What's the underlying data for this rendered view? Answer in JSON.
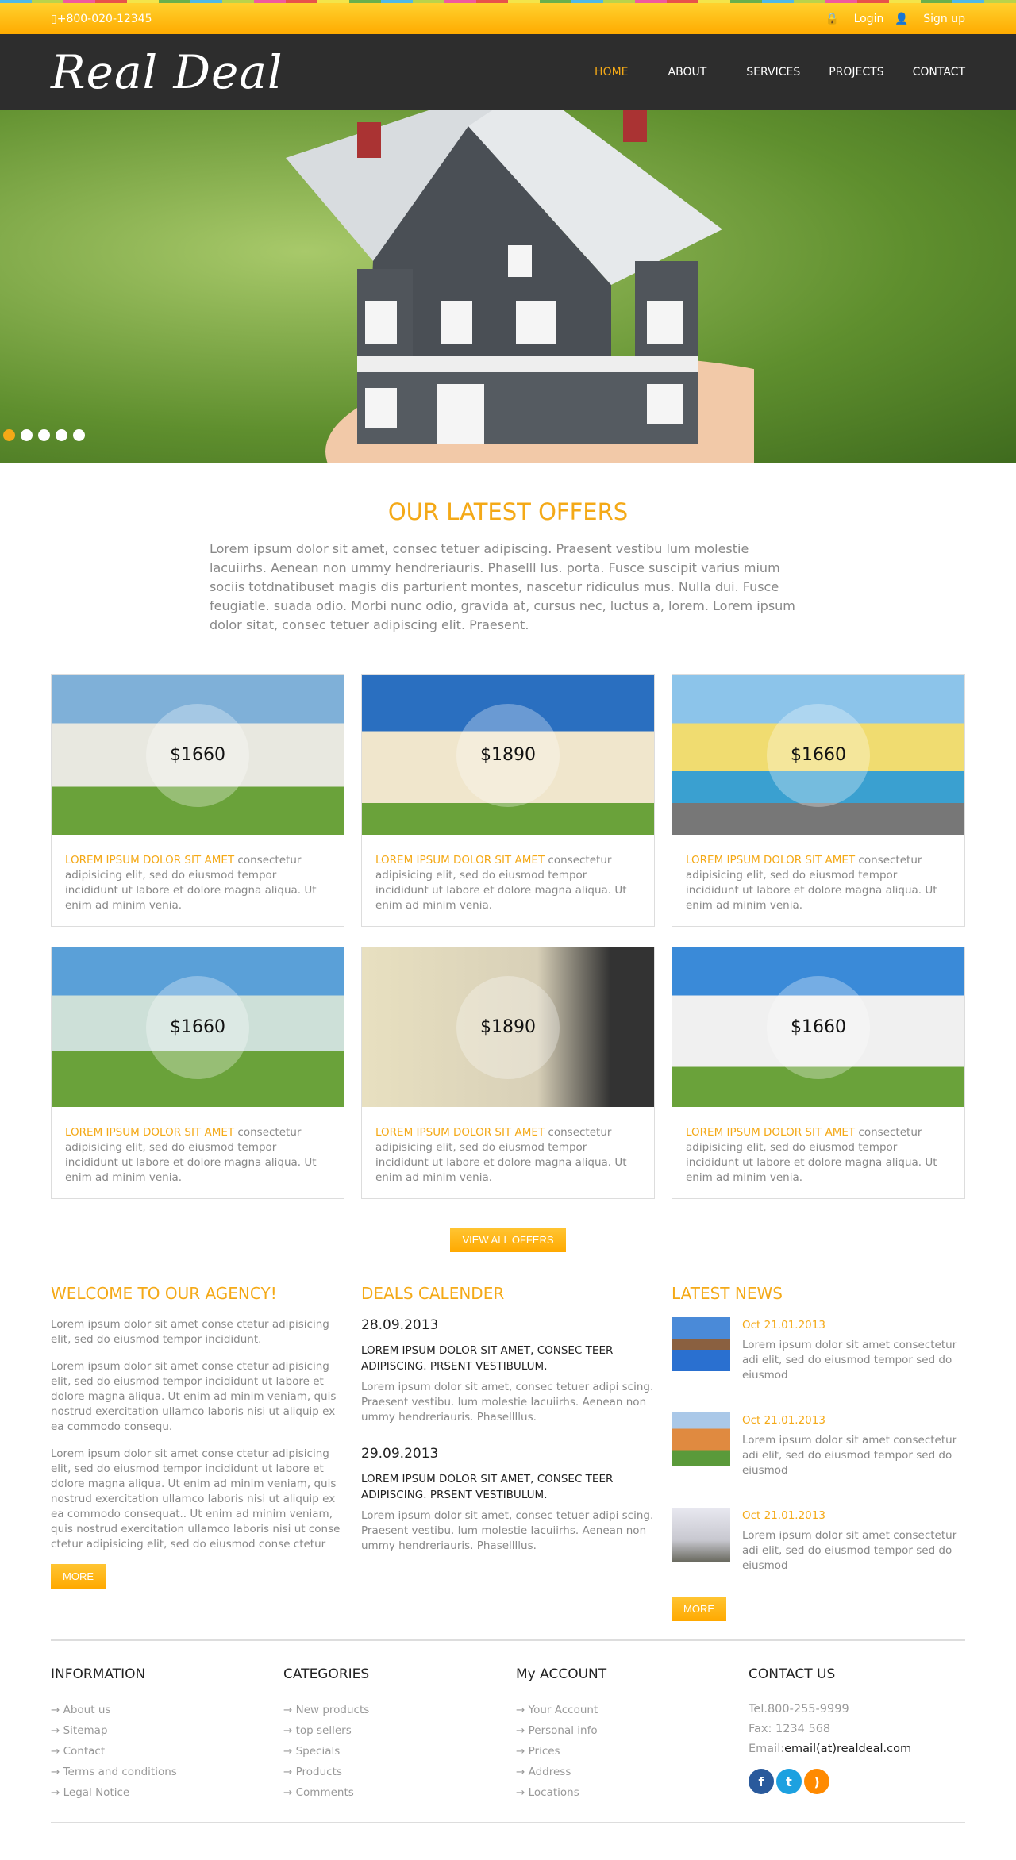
{
  "topbar": {
    "phone": "+800-020-12345",
    "login": "Login",
    "signup": "Sign up"
  },
  "brand": {
    "logo": "Real Deal"
  },
  "nav": [
    "HOME",
    "ABOUT",
    "SERVICES",
    "PROJECTS",
    "CONTACT"
  ],
  "slider": {
    "slides": 5,
    "active": 1
  },
  "offers": {
    "title": "OUR LATEST OFFERS",
    "intro": "Lorem ipsum dolor sit amet, consec tetuer adipiscing. Praesent vestibu lum molestie lacuiirhs. Aenean non ummy hendreriauris. Phaselll lus. porta. Fusce suscipit varius mium sociis totdnatibuset magis dis parturient montes, nascetur ridiculus mus. Nulla dui. Fusce feugiatle. suada odio. Morbi nunc odio, gravida at, cursus nec, luctus a, lorem. Lorem ipsum dolor sitat, consec tetuer adipiscing elit. Praesent.",
    "cards": [
      {
        "price": "$1660",
        "lead": "LOREM IPSUM DOLOR SIT AMET",
        "text": " consectetur adipisicing elit, sed do eiusmod tempor incididunt ut labore et dolore magna aliqua. Ut enim ad minim venia."
      },
      {
        "price": "$1890",
        "lead": "LOREM IPSUM DOLOR SIT AMET",
        "text": " consectetur adipisicing elit, sed do eiusmod tempor incididunt ut labore et dolore magna aliqua. Ut enim ad minim venia."
      },
      {
        "price": "$1660",
        "lead": "LOREM IPSUM DOLOR SIT AMET",
        "text": " consectetur adipisicing elit, sed do eiusmod tempor incididunt ut labore et dolore magna aliqua. Ut enim ad minim venia."
      },
      {
        "price": "$1660",
        "lead": "LOREM IPSUM DOLOR SIT AMET",
        "text": " consectetur adipisicing elit, sed do eiusmod tempor incididunt ut labore et dolore magna aliqua. Ut enim ad minim venia."
      },
      {
        "price": "$1890",
        "lead": "LOREM IPSUM DOLOR SIT AMET",
        "text": " consectetur adipisicing elit, sed do eiusmod tempor incididunt ut labore et dolore magna aliqua. Ut enim ad minim venia."
      },
      {
        "price": "$1660",
        "lead": "LOREM IPSUM DOLOR SIT AMET",
        "text": " consectetur adipisicing elit, sed do eiusmod tempor incididunt ut labore et dolore magna aliqua. Ut enim ad minim venia."
      }
    ],
    "view_all": "VIEW ALL OFFERS"
  },
  "welcome": {
    "title": "WELCOME TO OUR AGENCY!",
    "paras": [
      "Lorem ipsum dolor sit amet conse ctetur adipisicing elit, sed do eiusmod tempor incididunt.",
      "Lorem ipsum dolor sit amet conse ctetur adipisicing elit, sed do eiusmod tempor incididunt ut labore et dolore magna aliqua. Ut enim ad minim veniam, quis nostrud exercitation ullamco laboris nisi ut aliquip ex ea commodo consequ.",
      "Lorem ipsum dolor sit amet conse ctetur adipisicing elit, sed do eiusmod tempor incididunt ut labore et dolore magna aliqua. Ut enim ad minim veniam, quis nostrud exercitation ullamco laboris nisi ut aliquip ex ea commodo consequat.. Ut enim ad minim veniam, quis nostrud exercitation ullamco laboris nisi ut conse ctetur adipisicing elit, sed do eiusmod conse ctetur"
    ],
    "more": "MORE"
  },
  "deals": {
    "title": "DEALS CALENDER",
    "items": [
      {
        "date": "28.09.2013",
        "title": "LOREM IPSUM DOLOR SIT AMET, CONSEC TEER ADIPISCING. PRSENT VESTIBULUM.",
        "text": "Lorem ipsum dolor sit amet, consec tetuer adipi scing. Praesent vestibu. lum molestie lacuiirhs. Aenean non ummy hendreriauris. Phasellllus."
      },
      {
        "date": "29.09.2013",
        "title": "LOREM IPSUM DOLOR SIT AMET, CONSEC TEER ADIPISCING. PRSENT VESTIBULUM.",
        "text": "Lorem ipsum dolor sit amet, consec tetuer adipi scing. Praesent vestibu. lum molestie lacuiirhs. Aenean non ummy hendreriauris. Phasellllus."
      }
    ]
  },
  "news": {
    "title": "LATEST NEWS",
    "items": [
      {
        "date": "Oct 21.01.2013",
        "text": "Lorem ipsum dolor sit amet consectetur adi elit, sed do eiusmod tempor sed do eiusmod"
      },
      {
        "date": "Oct 21.01.2013",
        "text": "Lorem ipsum dolor sit amet consectetur adi elit, sed do eiusmod tempor sed do eiusmod"
      },
      {
        "date": "Oct 21.01.2013",
        "text": "Lorem ipsum dolor sit amet consectetur adi elit, sed do eiusmod tempor sed do eiusmod"
      }
    ],
    "more": "MORE"
  },
  "footer": {
    "information": {
      "title": "INFORMATION",
      "links": [
        "About us",
        "Sitemap",
        "Contact",
        "Terms and conditions",
        "Legal Notice"
      ]
    },
    "categories": {
      "title": "CATEGORIES",
      "links": [
        "New products",
        "top sellers",
        "Specials",
        "Products",
        "Comments"
      ]
    },
    "account": {
      "title": "My ACCOUNT",
      "links": [
        "Your Account",
        "Personal info",
        "Prices",
        "Address",
        "Locations"
      ]
    },
    "contact": {
      "title": "CONTACT US",
      "tel": "Tel.800-255-9999",
      "fax": "Fax: 1234 568",
      "email_label": "Email:",
      "email": "email(at)realdeal.com",
      "social": [
        "facebook-icon",
        "twitter-icon",
        "rss-icon"
      ]
    }
  },
  "colors": {
    "accent": "#f4a917",
    "nav_bg": "#2d2d2d",
    "facebook": "#2a5a9c",
    "twitter": "#1da1e0",
    "rss": "#ff8a00"
  }
}
